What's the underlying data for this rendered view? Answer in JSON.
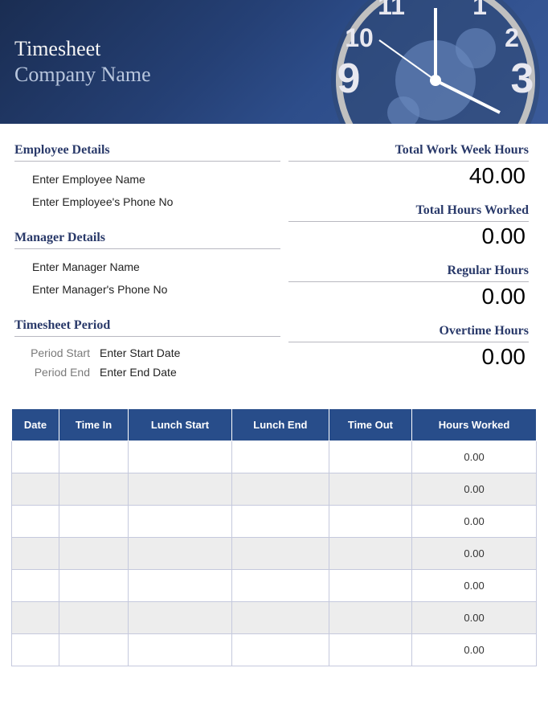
{
  "header": {
    "title": "Timesheet",
    "company": "Company Name"
  },
  "employee": {
    "heading": "Employee Details",
    "name_placeholder": "Enter Employee Name",
    "phone_placeholder": "Enter Employee's Phone No"
  },
  "manager": {
    "heading": "Manager Details",
    "name_placeholder": "Enter Manager Name",
    "phone_placeholder": "Enter Manager's Phone No"
  },
  "period": {
    "heading": "Timesheet Period",
    "start_label": "Period Start",
    "start_placeholder": "Enter Start Date",
    "end_label": "Period End",
    "end_placeholder": "Enter End Date"
  },
  "summary": {
    "work_week_label": "Total Work Week Hours",
    "work_week_value": "40.00",
    "total_worked_label": "Total Hours Worked",
    "total_worked_value": "0.00",
    "regular_label": "Regular Hours",
    "regular_value": "0.00",
    "overtime_label": "Overtime Hours",
    "overtime_value": "0.00"
  },
  "table": {
    "headers": {
      "date": "Date",
      "time_in": "Time In",
      "lunch_start": "Lunch Start",
      "lunch_end": "Lunch End",
      "time_out": "Time Out",
      "hours_worked": "Hours Worked"
    },
    "rows": [
      {
        "date": "",
        "time_in": "",
        "lunch_start": "",
        "lunch_end": "",
        "time_out": "",
        "hours_worked": "0.00"
      },
      {
        "date": "",
        "time_in": "",
        "lunch_start": "",
        "lunch_end": "",
        "time_out": "",
        "hours_worked": "0.00"
      },
      {
        "date": "",
        "time_in": "",
        "lunch_start": "",
        "lunch_end": "",
        "time_out": "",
        "hours_worked": "0.00"
      },
      {
        "date": "",
        "time_in": "",
        "lunch_start": "",
        "lunch_end": "",
        "time_out": "",
        "hours_worked": "0.00"
      },
      {
        "date": "",
        "time_in": "",
        "lunch_start": "",
        "lunch_end": "",
        "time_out": "",
        "hours_worked": "0.00"
      },
      {
        "date": "",
        "time_in": "",
        "lunch_start": "",
        "lunch_end": "",
        "time_out": "",
        "hours_worked": "0.00"
      },
      {
        "date": "",
        "time_in": "",
        "lunch_start": "",
        "lunch_end": "",
        "time_out": "",
        "hours_worked": "0.00"
      }
    ]
  }
}
